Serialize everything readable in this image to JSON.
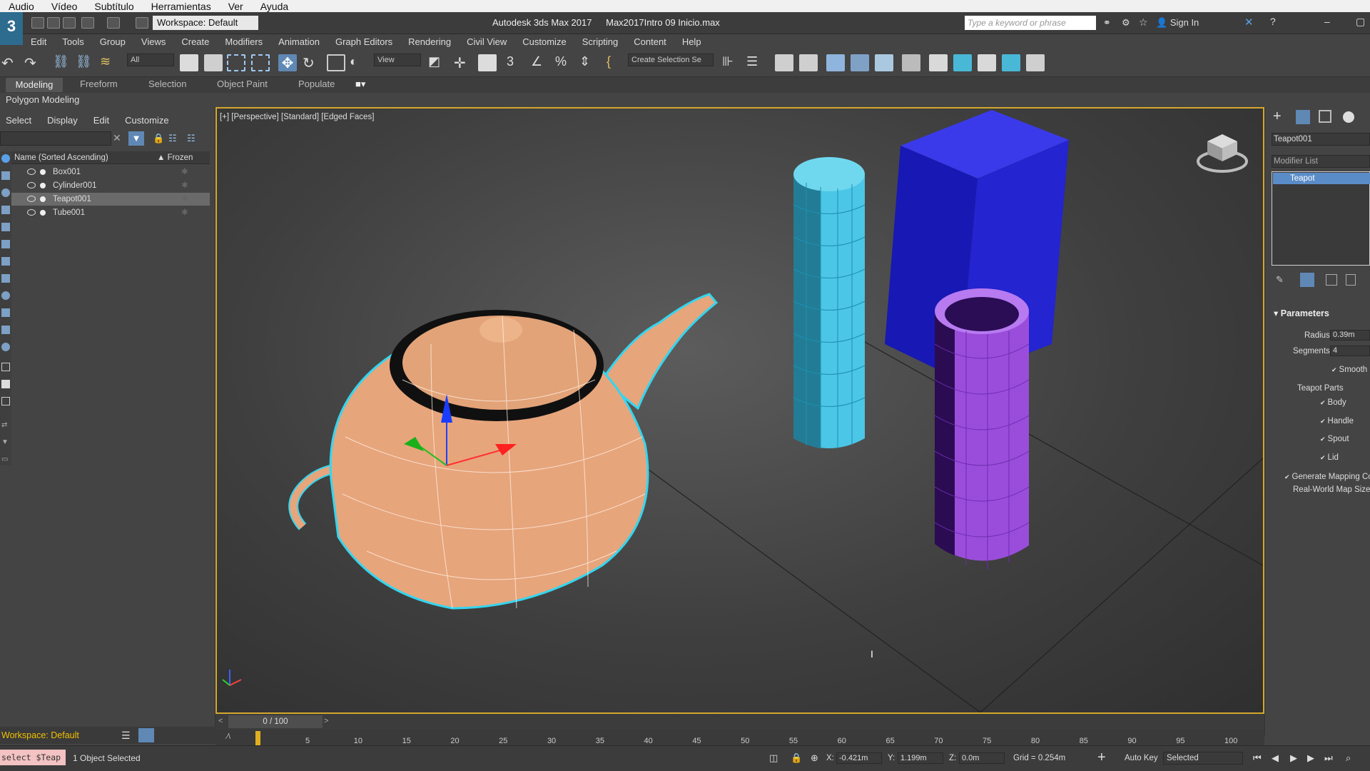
{
  "player_menu": [
    "Audio",
    "Vídeo",
    "Subtítulo",
    "Herramientas",
    "Ver",
    "Ayuda"
  ],
  "titlebar": {
    "workspace": "Workspace: Default",
    "app_title": "Autodesk 3ds Max 2017",
    "file_name": "Max2017Intro 09 Inicio.max",
    "search_placeholder": "Type a keyword or phrase",
    "sign_in": "Sign In"
  },
  "menubar": [
    "Edit",
    "Tools",
    "Group",
    "Views",
    "Create",
    "Modifiers",
    "Animation",
    "Graph Editors",
    "Rendering",
    "Civil View",
    "Customize",
    "Scripting",
    "Content",
    "Help"
  ],
  "toolbar": {
    "selection_filter": "All",
    "ref_coord": "View",
    "create_selection_set": "Create Selection Se"
  },
  "ribbon": {
    "tabs": [
      "Modeling",
      "Freeform",
      "Selection",
      "Object Paint",
      "Populate"
    ],
    "panel_label": "Polygon Modeling"
  },
  "explorer": {
    "menu": [
      "Select",
      "Display",
      "Edit",
      "Customize"
    ],
    "header_name": "Name (Sorted Ascending)",
    "header_frozen": "▲ Frozen",
    "rows": [
      "Box001",
      "Cylinder001",
      "Teapot001",
      "Tube001"
    ],
    "footer_workspace": "Workspace: Default"
  },
  "viewport": {
    "label": "[+] [Perspective] [Standard] [Edged Faces]"
  },
  "command_panel": {
    "object_name": "Teapot001",
    "modifier_list": "Modifier List",
    "stack_item": "Teapot",
    "parameters_title": "Parameters",
    "radius_label": "Radius:",
    "radius_value": "0.39m",
    "segments_label": "Segments:",
    "segments_value": "4",
    "smooth": "Smooth",
    "teapot_parts": "Teapot Parts",
    "parts": [
      "Body",
      "Handle",
      "Spout",
      "Lid"
    ],
    "gen_mapping": "Generate Mapping Co",
    "real_world": "Real-World Map Size"
  },
  "timeline": {
    "position": "0 / 100",
    "ticks": [
      "5",
      "10",
      "15",
      "20",
      "25",
      "30",
      "35",
      "40",
      "45",
      "50",
      "55",
      "60",
      "65",
      "70",
      "75",
      "80",
      "85",
      "90",
      "95",
      "100"
    ]
  },
  "statusbar": {
    "maxscript": "select $Teap",
    "message": "1 Object Selected",
    "x_label": "X:",
    "x_value": "-0.421m",
    "y_label": "Y:",
    "y_value": "1.199m",
    "z_label": "Z:",
    "z_value": "0.0m",
    "grid": "Grid = 0.254m",
    "auto_key": "Auto Key",
    "selected": "Selected"
  },
  "colors": {
    "viewport_border": "#d4a72c",
    "selection_cyan": "#33d6f0",
    "teapot": "#e7a57c",
    "cylinder": "#4bc6e6",
    "box": "#2020c8",
    "tube": "#9a4ddb"
  }
}
